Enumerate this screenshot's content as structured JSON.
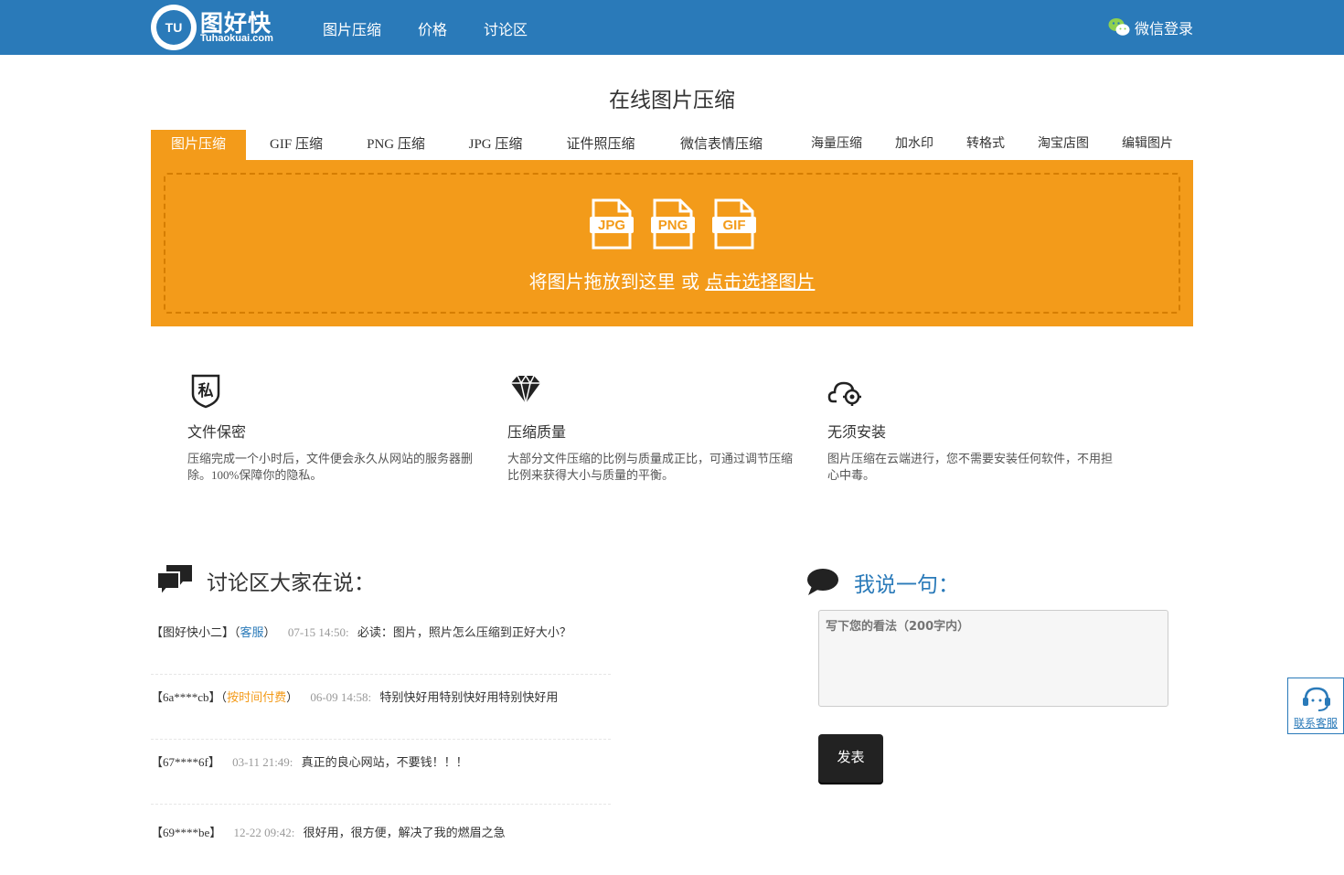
{
  "header": {
    "logo_main": "图好快",
    "logo_sub": "Tuhaokuai.com",
    "logo_badge": "TU",
    "nav": [
      "图片压缩",
      "价格",
      "讨论区"
    ],
    "login": "微信登录"
  },
  "page_title": "在线图片压缩",
  "tabs": [
    "图片压缩",
    "GIF 压缩",
    "PNG 压缩",
    "JPG 压缩",
    "证件照压缩",
    "微信表情压缩",
    "海量压缩",
    "加水印",
    "转格式",
    "淘宝店图",
    "编辑图片"
  ],
  "upload": {
    "formats": [
      "JPG",
      "PNG",
      "GIF"
    ],
    "text": "将图片拖放到这里 或",
    "link": "点击选择图片"
  },
  "features": [
    {
      "icon": "private-shield-icon",
      "glyph": "私",
      "title": "文件保密",
      "desc": "压缩完成一个小时后，文件便会永久从网站的服务器删除。100%保障你的隐私。"
    },
    {
      "icon": "diamond-icon",
      "title": "压缩质量",
      "desc": "大部分文件压缩的比例与质量成正比，可通过调节压缩比例来获得大小与质量的平衡。"
    },
    {
      "icon": "cloud-gear-icon",
      "title": "无须安装",
      "desc": "图片压缩在云端进行，您不需要安装任何软件，不用担心中毒。"
    }
  ],
  "discussion": {
    "title": "讨论区大家在说：",
    "comments": [
      {
        "user": "【图好快小二】",
        "tag_open": "（",
        "tag": "客服",
        "tag_close": "）",
        "time": "07-15 14:50:",
        "text": "必读：图片，照片怎么压缩到正好大小？"
      },
      {
        "user": "【6a****cb】",
        "tag_open": "（",
        "tag": "按时间付费",
        "tag_close": "）",
        "time": "06-09 14:58:",
        "text": "特别快好用特别快好用特别快好用"
      },
      {
        "user": "【67****6f】",
        "time": "03-11 21:49:",
        "text": "真正的良心网站，不要钱！！！"
      },
      {
        "user": "【69****be】",
        "time": "12-22 09:42:",
        "text": "很好用，很方便，解决了我的燃眉之急"
      }
    ]
  },
  "say": {
    "title": "我说一句：",
    "placeholder": "写下您的看法（200字内）",
    "button": "发表"
  },
  "customer_service": "联系客服",
  "colors": {
    "brand_blue": "#2a7ab9",
    "accent_orange": "#f39b1a"
  }
}
